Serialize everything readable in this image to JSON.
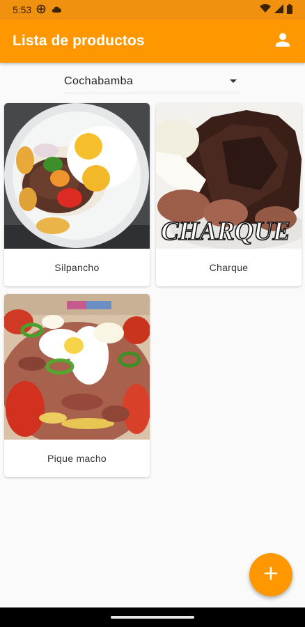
{
  "status_bar": {
    "time": "5:53"
  },
  "app_bar": {
    "title": "Lista de productos"
  },
  "city_selector": {
    "selected": "Cochabamba"
  },
  "products": [
    {
      "name": "Silpancho"
    },
    {
      "name": "Charque",
      "image_caption": "CHARQUE"
    },
    {
      "name": "Pique macho"
    }
  ],
  "fab": {
    "label": "+"
  },
  "colors": {
    "primary": "#ff9800",
    "status_bar": "#f0910f",
    "background": "#fafafa"
  },
  "icons": {
    "status_left": [
      "signal-sim-icon",
      "cloud-icon"
    ],
    "status_right": [
      "wifi-icon",
      "cell-signal-icon",
      "battery-icon"
    ],
    "app_bar": "account-icon",
    "fab": "add-icon"
  }
}
